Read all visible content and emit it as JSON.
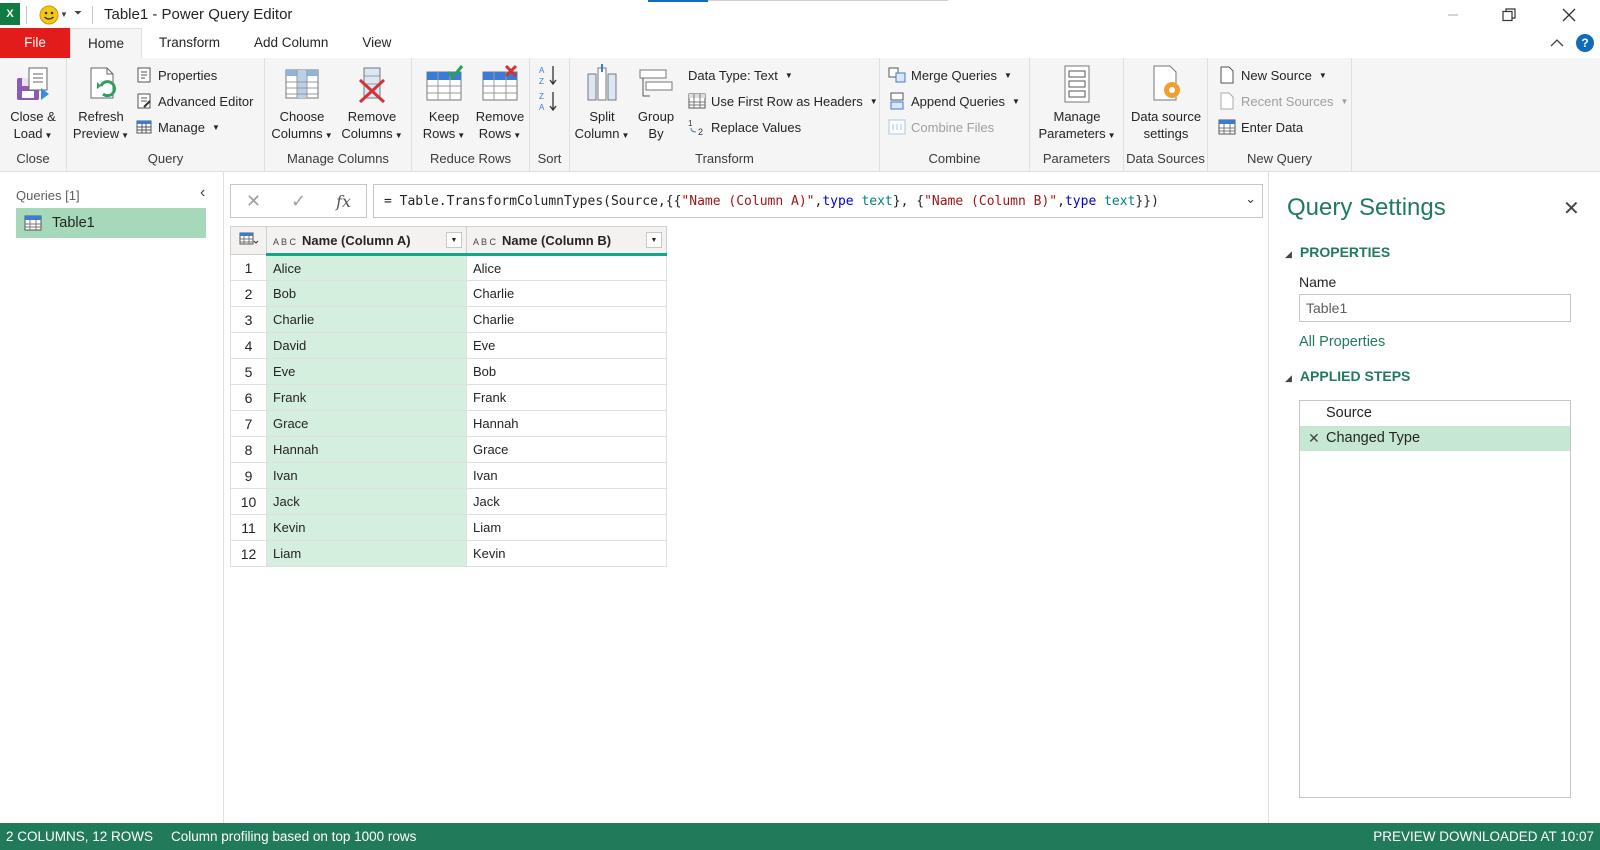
{
  "window": {
    "title": "Table1 - Power Query Editor"
  },
  "tabs": [
    "File",
    "Home",
    "Transform",
    "Add Column",
    "View"
  ],
  "ribbon": {
    "close": {
      "label": "Close",
      "close_load": [
        "Close &",
        "Load"
      ]
    },
    "query": {
      "label": "Query",
      "refresh": [
        "Refresh",
        "Preview"
      ],
      "properties": "Properties",
      "advanced_editor": "Advanced Editor",
      "manage": "Manage"
    },
    "manage_columns": {
      "label": "Manage Columns",
      "choose": [
        "Choose",
        "Columns"
      ],
      "remove": [
        "Remove",
        "Columns"
      ]
    },
    "reduce_rows": {
      "label": "Reduce Rows",
      "keep": [
        "Keep",
        "Rows"
      ],
      "remove": [
        "Remove",
        "Rows"
      ]
    },
    "sort": {
      "label": "Sort"
    },
    "transform": {
      "label": "Transform",
      "split": [
        "Split",
        "Column"
      ],
      "group": [
        "Group",
        "By"
      ],
      "data_type": "Data Type: Text",
      "first_row": "Use First Row as Headers",
      "replace": "Replace Values"
    },
    "combine": {
      "label": "Combine",
      "merge": "Merge Queries",
      "append": "Append Queries",
      "combine_files": "Combine Files"
    },
    "parameters": {
      "label": "Parameters",
      "manage": [
        "Manage",
        "Parameters"
      ]
    },
    "data_sources": {
      "label": "Data Sources",
      "settings": [
        "Data source",
        "settings"
      ]
    },
    "new_query": {
      "label": "New Query",
      "new_source": "New Source",
      "recent_sources": "Recent Sources",
      "enter_data": "Enter Data"
    }
  },
  "queries_pane": {
    "header": "Queries [1]",
    "items": [
      "Table1"
    ]
  },
  "formula": {
    "prefix": "= Table.TransformColumnTypes(Source,{{",
    "col_a": "\"Name (Column A)\"",
    "col_b": "\"Name (Column B)\"",
    "type_kw": "type",
    "type_val": "text",
    "sep1": ", ",
    "sep2": "}, {",
    "suffix": "}})"
  },
  "grid": {
    "type_badge": "A B C",
    "columns": [
      "Name (Column A)",
      "Name (Column B)"
    ],
    "rows": [
      [
        "Alice",
        "Alice"
      ],
      [
        "Bob",
        "Charlie"
      ],
      [
        "Charlie",
        "Charlie"
      ],
      [
        "David",
        "Eve"
      ],
      [
        "Eve",
        "Bob"
      ],
      [
        "Frank",
        "Frank"
      ],
      [
        "Grace",
        "Hannah"
      ],
      [
        "Hannah",
        "Grace"
      ],
      [
        "Ivan",
        "Ivan"
      ],
      [
        "Jack",
        "Jack"
      ],
      [
        "Kevin",
        "Liam"
      ],
      [
        "Liam",
        "Kevin"
      ]
    ]
  },
  "settings": {
    "title": "Query Settings",
    "properties_header": "PROPERTIES",
    "name_label": "Name",
    "name_value": "Table1",
    "all_properties": "All Properties",
    "steps_header": "APPLIED STEPS",
    "steps": [
      "Source",
      "Changed Type"
    ]
  },
  "status": {
    "counts": "2 COLUMNS, 12 ROWS",
    "profiling": "Column profiling based on top 1000 rows",
    "preview": "PREVIEW DOWNLOADED AT 10:07"
  },
  "colors": {
    "accent_green": "#217a5a",
    "file_red": "#e21b1b",
    "selection_green": "#a6d9b9"
  }
}
